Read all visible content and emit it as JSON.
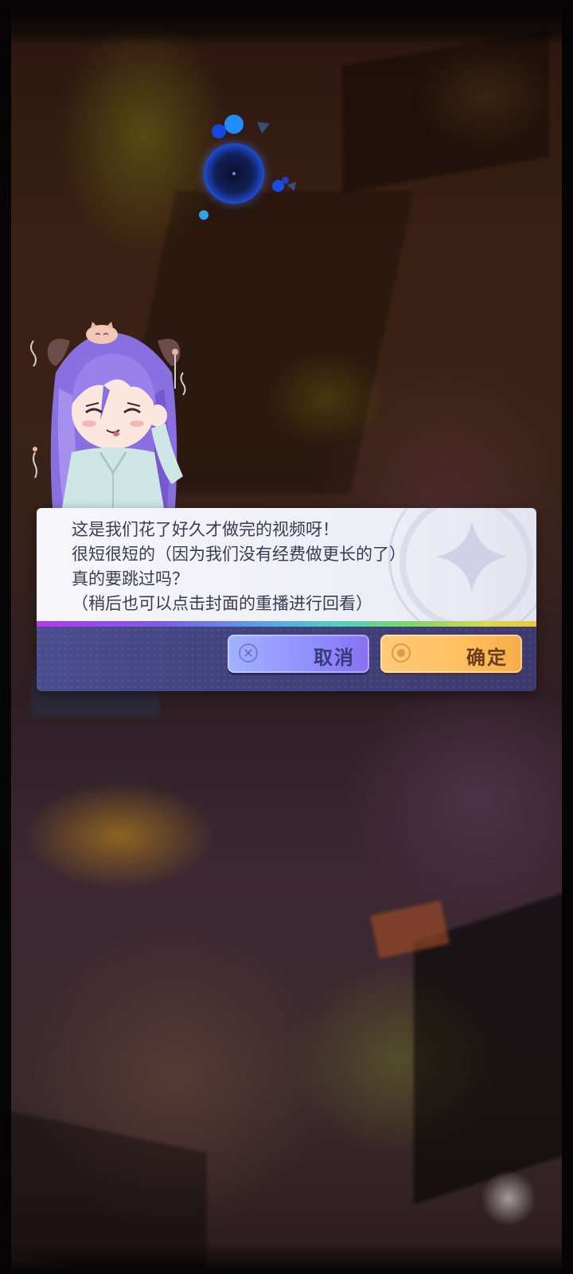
{
  "dialog": {
    "lines": [
      "这是我们花了好久才做完的视频呀！",
      "很短很短的（因为我们没有经费做更长的了）",
      "真的要跳过吗？",
      "（稍后也可以点击封面的重播进行回看）"
    ],
    "cancel_label": "取消",
    "confirm_label": "确定"
  },
  "icons": {
    "cancel": "close-circle-icon",
    "confirm": "confirm-circle-icon",
    "loading": "loading-orb-icon"
  },
  "colors": {
    "cancel_button": "#9aa0ff",
    "confirm_button": "#ffc46a",
    "dialog_text": "#3b3b54",
    "dialog_footer": "#44467f"
  }
}
